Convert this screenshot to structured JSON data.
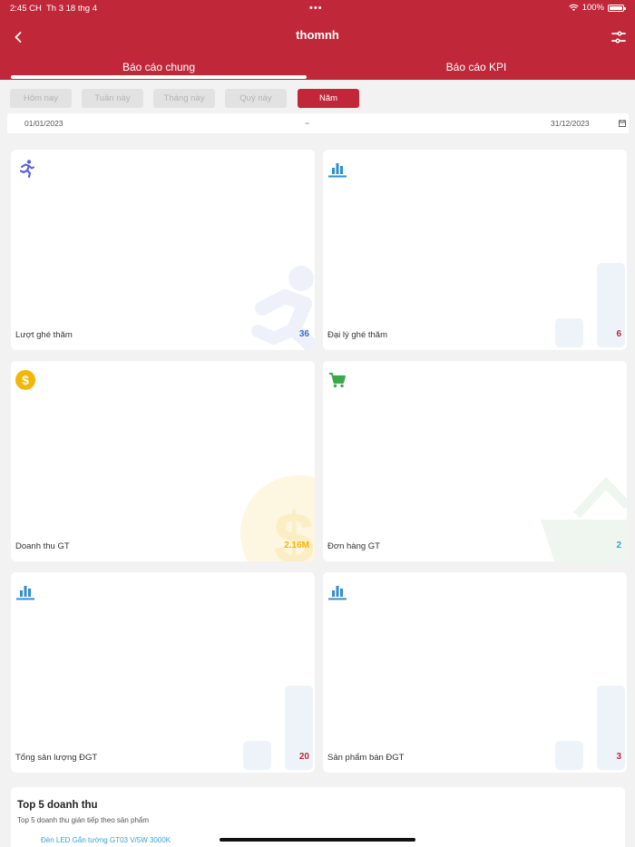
{
  "status_bar": {
    "time": "2:45 CH",
    "date": "Th 3 18 thg 4",
    "dots": "•••",
    "battery": "100%"
  },
  "header": {
    "title": "thomnh"
  },
  "tabs": {
    "general": "Báo cáo chung",
    "kpi": "Báo cáo KPI",
    "active": "general"
  },
  "periods": [
    "Hôm nay",
    "Tuần này",
    "Tháng này",
    "Quý này",
    "Năm"
  ],
  "active_period": "Năm",
  "date_range": {
    "from": "01/01/2023",
    "separator": "~",
    "to": "31/12/2023"
  },
  "cards": [
    {
      "label": "Lượt ghé thăm",
      "value": "36",
      "icon": "runner-icon",
      "color": "#3f6bdc"
    },
    {
      "label": "Đại lý ghé thăm",
      "value": "6",
      "icon": "bar-chart-icon",
      "color": "#c0283a"
    },
    {
      "label": "Doanh thu GT",
      "value": "2.16M",
      "icon": "dollar-icon",
      "color": "#f2b705"
    },
    {
      "label": "Đơn hàng GT",
      "value": "2",
      "icon": "cart-icon",
      "color": "#3a9fd8"
    },
    {
      "label": "Tổng sản lượng ĐGT",
      "value": "20",
      "icon": "bar-chart-icon",
      "color": "#c0283a"
    },
    {
      "label": "Sản phẩm bán ĐGT",
      "value": "3",
      "icon": "bar-chart-icon",
      "color": "#c0283a"
    }
  ],
  "top5": {
    "title": "Top 5 doanh thu",
    "subtitle": "Top 5 doanh thu gián tiếp theo sản phẩm",
    "first_item": "Đèn LED Gắn tường GT03 V/5W 3000K"
  },
  "colors": {
    "brand": "#c0283a",
    "accent_blue": "#3a9fd8",
    "icon_blue": "#2f8fd0",
    "icon_green": "#3ba84a",
    "icon_purple": "#5a5fe0",
    "icon_gold": "#f2b705"
  }
}
